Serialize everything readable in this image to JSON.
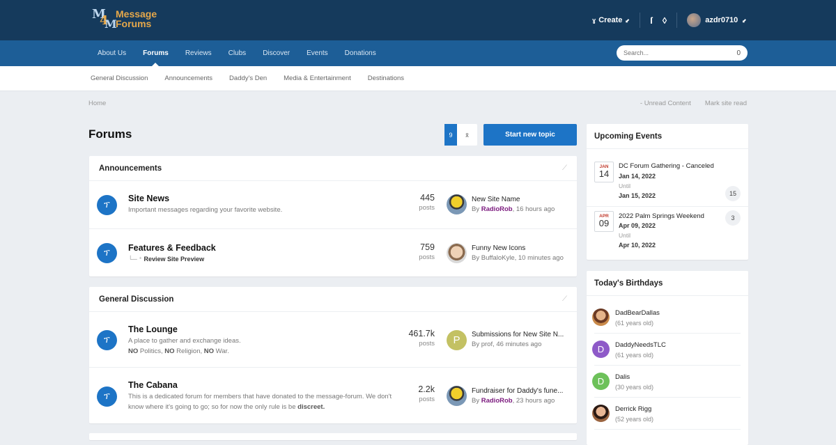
{
  "header": {
    "logo_line1": "Message",
    "logo_line2": "Forums",
    "create_label": "Create",
    "username": "azdr0710"
  },
  "nav": {
    "items": [
      {
        "label": "About Us"
      },
      {
        "label": "Forums"
      },
      {
        "label": "Reviews"
      },
      {
        "label": "Clubs"
      },
      {
        "label": "Discover"
      },
      {
        "label": "Events"
      },
      {
        "label": "Donations"
      }
    ],
    "active": "Forums",
    "search_placeholder": "Search..."
  },
  "subnav": {
    "items": [
      {
        "label": "General Discussion"
      },
      {
        "label": "Announcements"
      },
      {
        "label": "Daddy's Den"
      },
      {
        "label": "Media & Entertainment"
      },
      {
        "label": "Destinations"
      }
    ]
  },
  "breadcrumb": {
    "home": "Home",
    "unread": "Unread Content",
    "mark_read": "Mark site read"
  },
  "page": {
    "title": "Forums",
    "toggle_a": "9",
    "toggle_b": "x̄",
    "new_topic_label": "Start new topic"
  },
  "sections": [
    {
      "title": "Announcements",
      "forums": [
        {
          "name": "Site News",
          "description": "Important messages regarding your favorite website.",
          "count": "445",
          "count_label": "posts",
          "last_title": "New Site Name",
          "last_by_prefix": "By",
          "last_by_user": "RadioRob",
          "last_when": ", 16 hours ago"
        },
        {
          "name": "Features & Feedback",
          "subforum": "Review Site Preview",
          "count": "759",
          "count_label": "posts",
          "last_title": "Funny New Icons",
          "last_by_prefix": "By",
          "last_by_user": "BuffaloKyle",
          "last_when": ", 10 minutes ago"
        }
      ]
    },
    {
      "title": "General Discussion",
      "forums": [
        {
          "name": "The Lounge",
          "description": "A place to gather and exchange ideas.",
          "desc_parts": [
            "NO",
            " Politics, ",
            "NO",
            " Religion, ",
            "NO",
            " War."
          ],
          "count": "461.7k",
          "count_label": "posts",
          "last_title": "Submissions for New Site N...",
          "last_by_prefix": "By",
          "last_by_user": "prof",
          "last_when": ", 46 minutes ago",
          "last_avatar_letter": "P"
        },
        {
          "name": "The Cabana",
          "description": "This is a dedicated forum for members that have donated to the message-forum. We don't know where it's going to go; so for now the only rule is be",
          "description_strong": "discreet.",
          "count": "2.2k",
          "count_label": "posts",
          "last_title": "Fundraiser for Daddy's fune...",
          "last_by_prefix": "By",
          "last_by_user": "RadioRob",
          "last_when": ", 23 hours ago"
        }
      ]
    }
  ],
  "events": {
    "title": "Upcoming Events",
    "items": [
      {
        "month": "JAN",
        "day": "14",
        "title": "DC Forum Gathering - Canceled",
        "start": "Jan 14, 2022",
        "until": "Until",
        "end": "Jan 15, 2022",
        "count": "15"
      },
      {
        "month": "APR",
        "day": "09",
        "title": "2022 Palm Springs Weekend",
        "start": "Apr 09, 2022",
        "until": "Until",
        "end": "Apr 10, 2022",
        "count": "3"
      }
    ]
  },
  "birthdays": {
    "title": "Today's Birthdays",
    "items": [
      {
        "name": "DadBearDallas",
        "age": "(61 years old)"
      },
      {
        "name": "DaddyNeedsTLC",
        "age": "(61 years old)",
        "letter": "D"
      },
      {
        "name": "Dalis",
        "age": "(30 years old)",
        "letter": "D"
      },
      {
        "name": "Derrick Rigg",
        "age": "(52 years old)"
      }
    ]
  },
  "colors": {
    "header_bg": "#153a5c",
    "nav_bg": "#1d5e97",
    "accent": "#1d74c6",
    "username_color": "#7b1a7e"
  }
}
